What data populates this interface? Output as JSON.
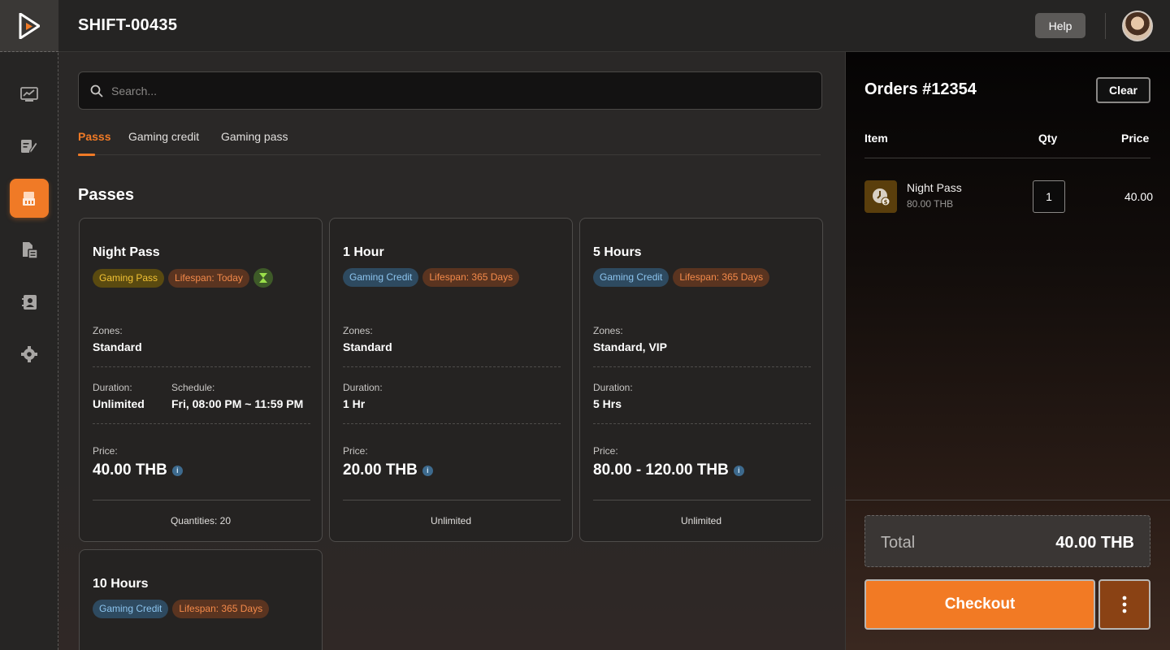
{
  "header": {
    "shift": "SHIFT-00435",
    "help_label": "Help"
  },
  "sidebar": {
    "items": [
      {
        "icon": "dashboard-chart-icon",
        "active": false
      },
      {
        "icon": "edit-list-icon",
        "active": false
      },
      {
        "icon": "shop-store-icon",
        "active": true
      },
      {
        "icon": "report-document-icon",
        "active": false
      },
      {
        "icon": "contacts-icon",
        "active": false
      },
      {
        "icon": "settings-gear-icon",
        "active": false
      }
    ]
  },
  "search": {
    "placeholder": "Search..."
  },
  "tabs": [
    {
      "label": "Passs",
      "active": true
    },
    {
      "label": "Gaming credit",
      "active": false
    },
    {
      "label": "Gaming pass",
      "active": false
    }
  ],
  "section_title": "Passes",
  "labels": {
    "zones": "Zones:",
    "duration": "Duration:",
    "schedule": "Schedule:",
    "price": "Price:"
  },
  "cards": [
    {
      "title": "Night Pass",
      "type_badge": "Gaming Pass",
      "lifespan": "Lifespan: Today",
      "zones": "Standard",
      "duration": "Unlimited",
      "schedule": "Fri, 08:00 PM ~ 11:59 PM",
      "price": "40.00 THB",
      "footer": "Quantities: 20"
    },
    {
      "title": "1 Hour",
      "type_badge": "Gaming Credit",
      "lifespan": "Lifespan: 365 Days",
      "zones": "Standard",
      "duration": "1 Hr",
      "price": "20.00 THB",
      "footer": "Unlimited"
    },
    {
      "title": "5 Hours",
      "type_badge": "Gaming Credit",
      "lifespan": "Lifespan: 365 Days",
      "zones": "Standard, VIP",
      "duration": "5 Hrs",
      "price": "80.00 - 120.00 THB",
      "footer": "Unlimited"
    },
    {
      "title": "10 Hours",
      "type_badge": "Gaming Credit",
      "lifespan": "Lifespan: 365 Days"
    }
  ],
  "orders": {
    "title": "Orders #12354",
    "clear_label": "Clear",
    "columns": {
      "item": "Item",
      "qty": "Qty",
      "price": "Price"
    },
    "items": [
      {
        "name": "Night Pass",
        "unit_price": "80.00 THB",
        "qty": "1",
        "price": "40.00"
      }
    ],
    "total_label": "Total",
    "total_value": "40.00 THB",
    "checkout_label": "Checkout"
  },
  "colors": {
    "accent": "#f07a26",
    "gaming_pass": "#f2c234",
    "gaming_credit": "#8cc4ee",
    "lifespan": "#f48a4a"
  }
}
